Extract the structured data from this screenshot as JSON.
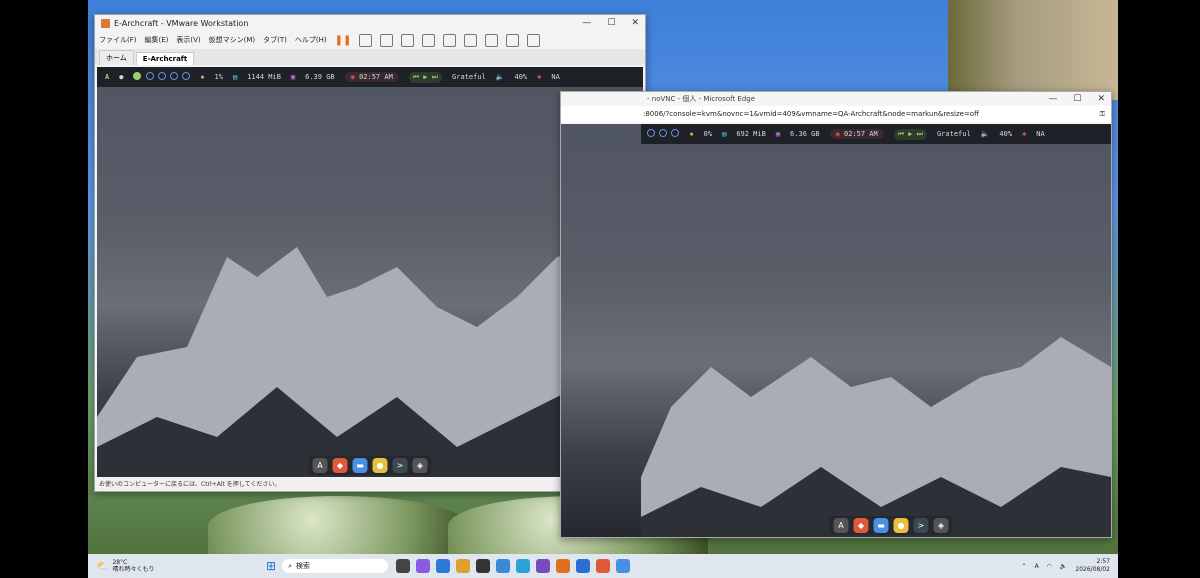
{
  "vmware": {
    "title": "E-Archcraft - VMware Workstation",
    "menu": [
      "ファイル(F)",
      "編集(E)",
      "表示(V)",
      "仮想マシン(M)",
      "タブ(T)",
      "ヘルプ(H)"
    ],
    "tabs": [
      "ホーム",
      "E-Archcraft"
    ],
    "status_text": "お使いのコンピューターに戻るには、Ctrl+Alt を押してください。"
  },
  "guest_bar_vm": {
    "cpu": "1%",
    "mem": "1144 MiB",
    "disk": "6.39 GB",
    "time": "02:57 AM",
    "track": "Grateful",
    "volume": "40%",
    "net": "NA"
  },
  "edge": {
    "title": "- noVNC - 個人 - Microsoft Edge",
    "url": ":8006/?console=kvm&novnc=1&vmid=409&vmname=QA-Archcraft&node=markun&resize=off"
  },
  "guest_bar_edge": {
    "cpu": "0%",
    "mem": "692 MiB",
    "disk": "6.36 GB",
    "time": "02:57 AM",
    "track": "Grateful",
    "volume": "40%",
    "net": "NA"
  },
  "taskbar": {
    "weather_temp": "28°C",
    "weather_desc": "晴れ時々くもり",
    "search_placeholder": "検索",
    "time": "2:57",
    "date": "2026/08/02",
    "ime": "A"
  },
  "colors": {
    "accent": "#9ad06a",
    "bar_bg": "#1f2129"
  }
}
